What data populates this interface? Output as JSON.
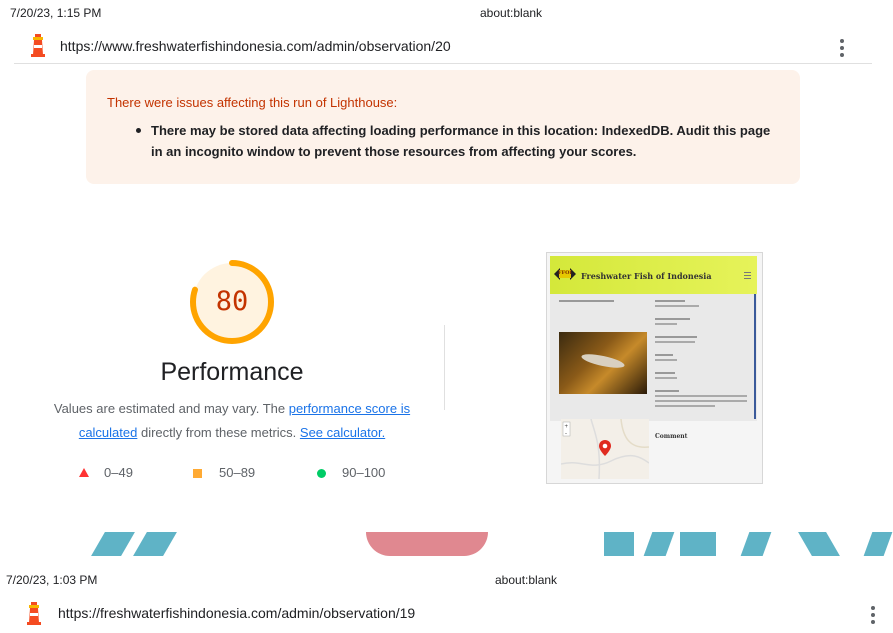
{
  "print_header_top": {
    "date": "7/20/23, 1:15 PM",
    "title": "about:blank"
  },
  "url_bar_top": {
    "url": "https://www.freshwaterfishindonesia.com/admin/observation/20"
  },
  "warning": {
    "title": "There were issues affecting this run of Lighthouse:",
    "items": [
      "There may be stored data affecting loading performance in this location: IndexedDB. Audit this page in an incognito window to prevent those resources from affecting your scores."
    ]
  },
  "gauge": {
    "score": "80",
    "value": 80,
    "color": "#ffa400",
    "label": "Performance"
  },
  "description": {
    "part1": "Values are estimated and may vary. The ",
    "link1": "performance score is calculated",
    "part2": " directly from these metrics. ",
    "link2": "See calculator."
  },
  "legend": [
    {
      "label": "0–49",
      "color": "#ff3333"
    },
    {
      "label": "50–89",
      "color": "#ffaa33"
    },
    {
      "label": "90–100",
      "color": "#00cc66"
    }
  ],
  "screenshot": {
    "site_title": "Freshwater Fish of Indonesia",
    "logo_text": "FFOI",
    "comment_label": "Comment"
  },
  "print_header_bottom": {
    "date": "7/20/23, 1:03 PM",
    "title": "about:blank"
  },
  "url_bar_bottom": {
    "url": "https://freshwaterfishindonesia.com/admin/observation/19"
  }
}
